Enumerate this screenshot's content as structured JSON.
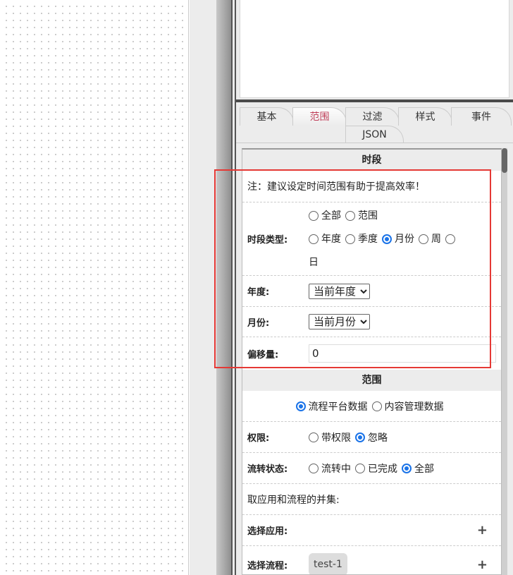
{
  "tabs": [
    "基本",
    "范围",
    "过滤",
    "样式",
    "事件",
    "JSON"
  ],
  "active_tab": "范围",
  "period": {
    "title": "时段",
    "note": "注：建议设定时间范围有助于提高效率！",
    "type_label": "时段类型:",
    "type_options": [
      "全部",
      "范围",
      "年度",
      "季度",
      "月份",
      "周",
      "日"
    ],
    "type_selected": "月份",
    "year_label": "年度:",
    "year_value": "当前年度",
    "month_label": "月份:",
    "month_value": "当前月份",
    "offset_label": "偏移量:",
    "offset_value": "0"
  },
  "scope": {
    "title": "范围",
    "source_options": [
      "流程平台数据",
      "内容管理数据"
    ],
    "source_selected": "流程平台数据",
    "perm_label": "权限:",
    "perm_options": [
      "带权限",
      "忽略"
    ],
    "perm_selected": "忽略",
    "status_label": "流转状态:",
    "status_options": [
      "流转中",
      "已完成",
      "全部"
    ],
    "status_selected": "全部",
    "union_note": "取应用和流程的并集:",
    "app_label": "选择应用:",
    "flow_label": "选择流程:",
    "flow_chip": "test-1",
    "add_icon": "+"
  }
}
